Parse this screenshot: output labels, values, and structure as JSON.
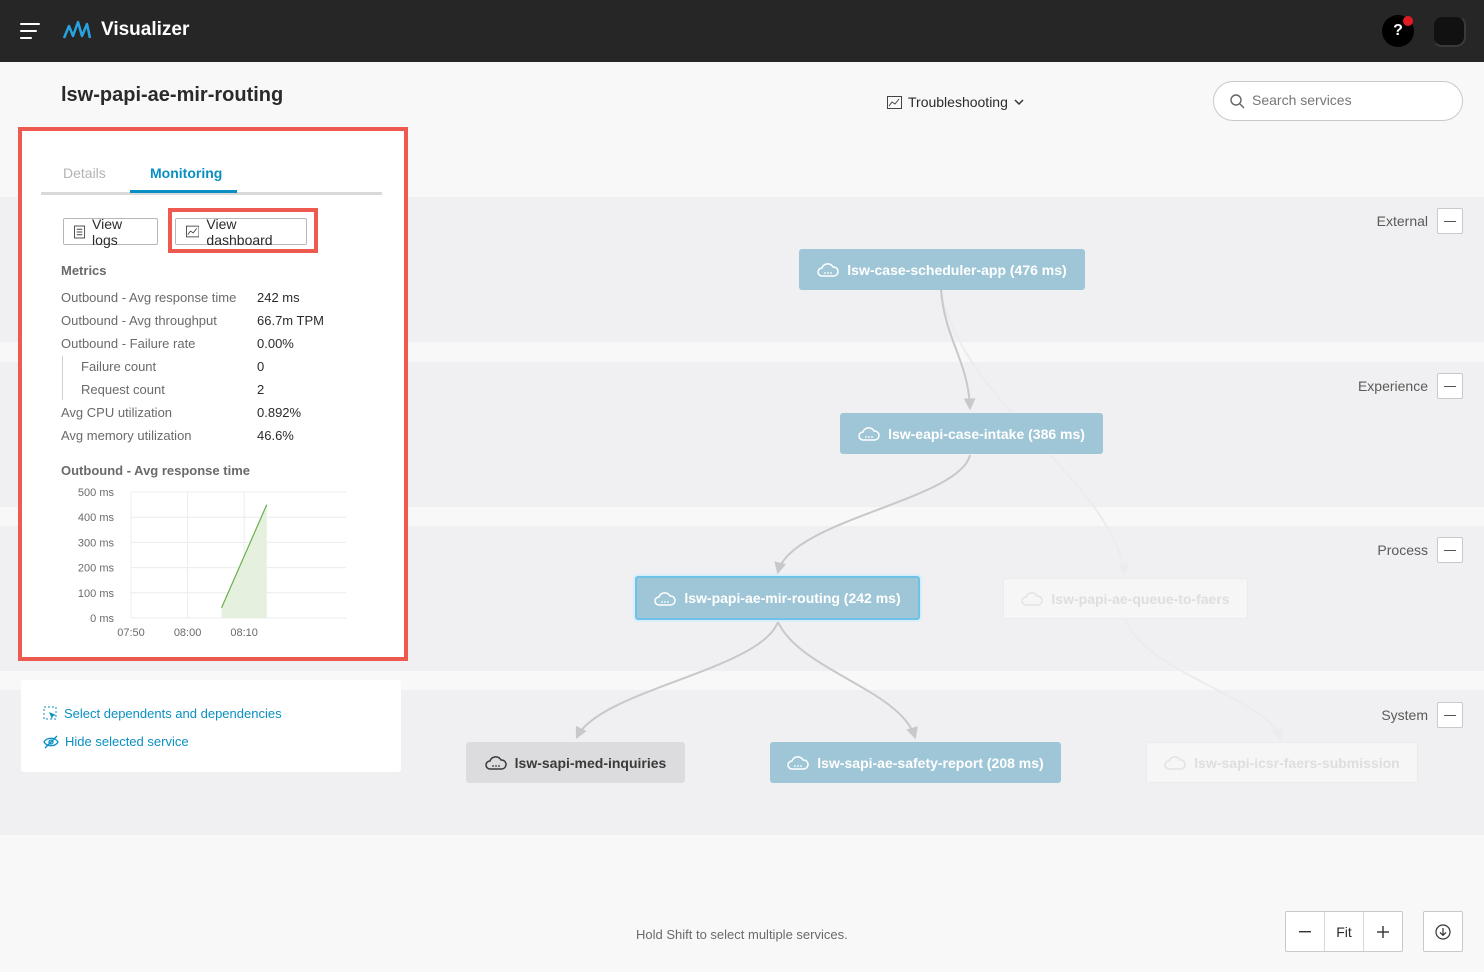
{
  "app": {
    "title": "Visualizer",
    "help_label": "?"
  },
  "page": {
    "title": "lsw-papi-ae-mir-routing"
  },
  "view_select": {
    "label": "Troubleshooting"
  },
  "search": {
    "placeholder": "Search services",
    "value": ""
  },
  "layers": [
    {
      "label": "External"
    },
    {
      "label": "Experience"
    },
    {
      "label": "Process"
    },
    {
      "label": "System"
    }
  ],
  "nodes": {
    "scheduler": "lsw-case-scheduler-app (476 ms)",
    "intake": "lsw-eapi-case-intake (386 ms)",
    "routing": "lsw-papi-ae-mir-routing (242 ms)",
    "queue": "lsw-papi-ae-queue-to-faers",
    "med": "lsw-sapi-med-inquiries",
    "safety": "lsw-sapi-ae-safety-report (208 ms)",
    "icsr": "lsw-sapi-icsr-faers-submission"
  },
  "panel": {
    "tabs": {
      "details": "Details",
      "monitoring": "Monitoring"
    },
    "buttons": {
      "view_logs": "View logs",
      "view_dashboard": "View dashboard"
    },
    "metrics_title": "Metrics",
    "metrics": [
      {
        "label": "Outbound - Avg response time",
        "value": "242 ms"
      },
      {
        "label": "Outbound - Avg throughput",
        "value": "66.7m TPM"
      },
      {
        "label": "Outbound - Failure rate",
        "value": "0.00%"
      },
      {
        "label": "Failure count",
        "value": "0"
      },
      {
        "label": "Request count",
        "value": "2"
      },
      {
        "label": "Avg CPU utilization",
        "value": "0.892%"
      },
      {
        "label": "Avg memory utilization",
        "value": "46.6%"
      }
    ],
    "chart_title": "Outbound - Avg response time"
  },
  "chart_data": {
    "type": "area",
    "title": "Outbound - Avg response time",
    "x_ticks": [
      "07:50",
      "08:00",
      "08:10"
    ],
    "y_ticks": [
      "500 ms",
      "400 ms",
      "300 ms",
      "200 ms",
      "100 ms",
      "0 ms"
    ],
    "ylim": [
      0,
      500
    ],
    "unit": "ms",
    "series": [
      {
        "x": [
          "08:06",
          "08:14"
        ],
        "values": [
          40,
          450
        ]
      }
    ],
    "grid": true,
    "color": "#6ab04c"
  },
  "actions": {
    "select_deps": "Select dependents and dependencies",
    "hide_service": "Hide selected service"
  },
  "footer": {
    "hint": "Hold Shift to select multiple services."
  },
  "zoom": {
    "fit_label": "Fit"
  },
  "colors": {
    "accent": "#0a8fc3",
    "node": "#9fc6d6",
    "highlight": "#ee5a4f",
    "header": "#262626"
  }
}
